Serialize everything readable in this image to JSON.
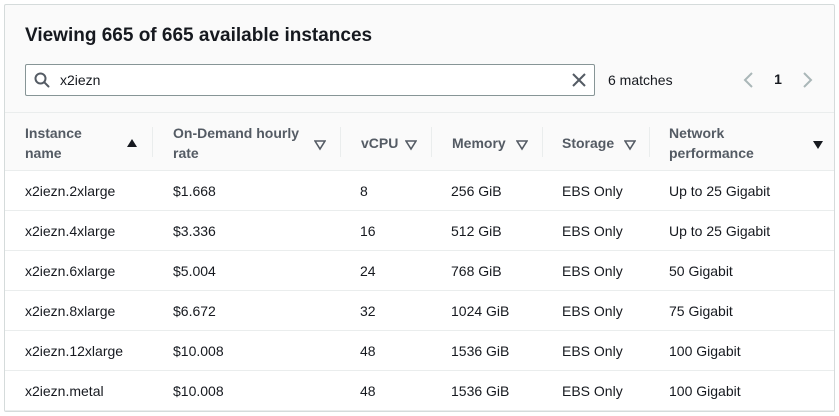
{
  "panel": {
    "title": "Viewing 665 of 665 available instances"
  },
  "search": {
    "value": "x2iezn",
    "placeholder": ""
  },
  "filter": {
    "matches": "6 matches",
    "current_page": "1"
  },
  "table": {
    "columns": [
      {
        "label": "Instance\nname",
        "sort": "ascending"
      },
      {
        "label": "On-Demand hourly\nrate",
        "sort": "none"
      },
      {
        "label": "vCPU",
        "sort": "none"
      },
      {
        "label": "Memory",
        "sort": "none"
      },
      {
        "label": "Storage",
        "sort": "none"
      },
      {
        "label": "Network\nperformance",
        "sort": "none"
      }
    ],
    "rows": [
      [
        "x2iezn.2xlarge",
        "$1.668",
        "8",
        "256 GiB",
        "EBS Only",
        "Up to 25 Gigabit"
      ],
      [
        "x2iezn.4xlarge",
        "$3.336",
        "16",
        "512 GiB",
        "EBS Only",
        "Up to 25 Gigabit"
      ],
      [
        "x2iezn.6xlarge",
        "$5.004",
        "24",
        "768 GiB",
        "EBS Only",
        "50 Gigabit"
      ],
      [
        "x2iezn.8xlarge",
        "$6.672",
        "32",
        "1024 GiB",
        "EBS Only",
        "75 Gigabit"
      ],
      [
        "x2iezn.12xlarge",
        "$10.008",
        "48",
        "1536 GiB",
        "EBS Only",
        "100 Gigabit"
      ],
      [
        "x2iezn.metal",
        "$10.008",
        "48",
        "1536 GiB",
        "EBS Only",
        "100 Gigabit"
      ]
    ]
  },
  "icons": {
    "search": "search-icon",
    "clear": "close-icon",
    "prev": "chevron-left-icon",
    "next": "chevron-right-icon",
    "sort_asc": "sort-ascending-icon",
    "sort_none": "sort-dropdown-icon"
  },
  "colors": {
    "text": "#16191f",
    "header_text": "#545b64",
    "border": "#eaeded",
    "panel_bg": "#fafafa"
  }
}
